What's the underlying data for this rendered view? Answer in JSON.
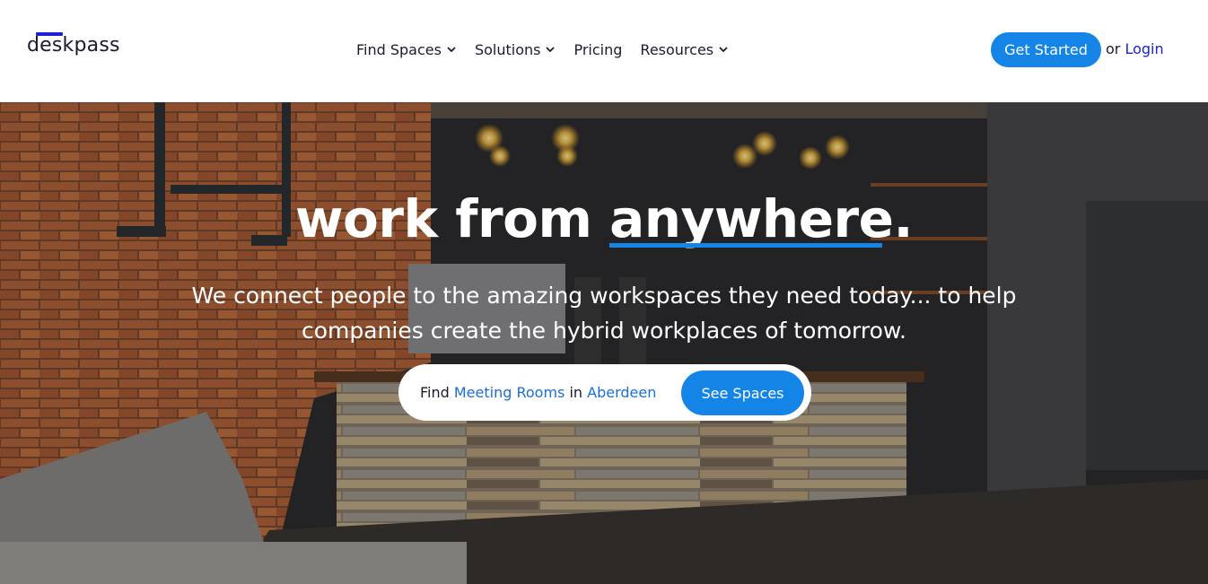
{
  "header": {
    "logo_text": "deskpass",
    "nav": [
      {
        "label": "Find Spaces",
        "has_dropdown": true
      },
      {
        "label": "Solutions",
        "has_dropdown": true
      },
      {
        "label": "Pricing",
        "has_dropdown": false
      },
      {
        "label": "Resources",
        "has_dropdown": true
      }
    ],
    "cta_label": "Get Started",
    "or_text": "or",
    "login_label": "Login"
  },
  "hero": {
    "title_pre": "work from",
    "title_highlight": "anywhere",
    "title_dot": ".",
    "subtitle": "We connect people to the amazing workspaces they need today... to help companies create the hybrid workplaces of tomorrow.",
    "search": {
      "find_label": "Find",
      "space_type": "Meeting Rooms",
      "in_label": "in",
      "city": "Aberdeen",
      "button_label": "See Spaces"
    }
  },
  "colors": {
    "accent": "#1485e6",
    "brand_dark": "#1a21d6",
    "link": "#1a6fd6"
  }
}
